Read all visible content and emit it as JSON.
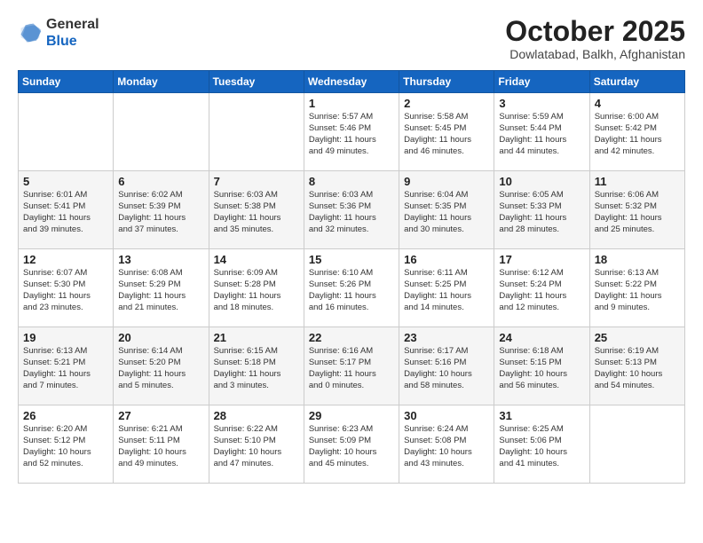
{
  "logo": {
    "general": "General",
    "blue": "Blue"
  },
  "title": "October 2025",
  "subtitle": "Dowlatabad, Balkh, Afghanistan",
  "weekdays": [
    "Sunday",
    "Monday",
    "Tuesday",
    "Wednesday",
    "Thursday",
    "Friday",
    "Saturday"
  ],
  "weeks": [
    [
      {
        "day": "",
        "info": ""
      },
      {
        "day": "",
        "info": ""
      },
      {
        "day": "",
        "info": ""
      },
      {
        "day": "1",
        "info": "Sunrise: 5:57 AM\nSunset: 5:46 PM\nDaylight: 11 hours\nand 49 minutes."
      },
      {
        "day": "2",
        "info": "Sunrise: 5:58 AM\nSunset: 5:45 PM\nDaylight: 11 hours\nand 46 minutes."
      },
      {
        "day": "3",
        "info": "Sunrise: 5:59 AM\nSunset: 5:44 PM\nDaylight: 11 hours\nand 44 minutes."
      },
      {
        "day": "4",
        "info": "Sunrise: 6:00 AM\nSunset: 5:42 PM\nDaylight: 11 hours\nand 42 minutes."
      }
    ],
    [
      {
        "day": "5",
        "info": "Sunrise: 6:01 AM\nSunset: 5:41 PM\nDaylight: 11 hours\nand 39 minutes."
      },
      {
        "day": "6",
        "info": "Sunrise: 6:02 AM\nSunset: 5:39 PM\nDaylight: 11 hours\nand 37 minutes."
      },
      {
        "day": "7",
        "info": "Sunrise: 6:03 AM\nSunset: 5:38 PM\nDaylight: 11 hours\nand 35 minutes."
      },
      {
        "day": "8",
        "info": "Sunrise: 6:03 AM\nSunset: 5:36 PM\nDaylight: 11 hours\nand 32 minutes."
      },
      {
        "day": "9",
        "info": "Sunrise: 6:04 AM\nSunset: 5:35 PM\nDaylight: 11 hours\nand 30 minutes."
      },
      {
        "day": "10",
        "info": "Sunrise: 6:05 AM\nSunset: 5:33 PM\nDaylight: 11 hours\nand 28 minutes."
      },
      {
        "day": "11",
        "info": "Sunrise: 6:06 AM\nSunset: 5:32 PM\nDaylight: 11 hours\nand 25 minutes."
      }
    ],
    [
      {
        "day": "12",
        "info": "Sunrise: 6:07 AM\nSunset: 5:30 PM\nDaylight: 11 hours\nand 23 minutes."
      },
      {
        "day": "13",
        "info": "Sunrise: 6:08 AM\nSunset: 5:29 PM\nDaylight: 11 hours\nand 21 minutes."
      },
      {
        "day": "14",
        "info": "Sunrise: 6:09 AM\nSunset: 5:28 PM\nDaylight: 11 hours\nand 18 minutes."
      },
      {
        "day": "15",
        "info": "Sunrise: 6:10 AM\nSunset: 5:26 PM\nDaylight: 11 hours\nand 16 minutes."
      },
      {
        "day": "16",
        "info": "Sunrise: 6:11 AM\nSunset: 5:25 PM\nDaylight: 11 hours\nand 14 minutes."
      },
      {
        "day": "17",
        "info": "Sunrise: 6:12 AM\nSunset: 5:24 PM\nDaylight: 11 hours\nand 12 minutes."
      },
      {
        "day": "18",
        "info": "Sunrise: 6:13 AM\nSunset: 5:22 PM\nDaylight: 11 hours\nand 9 minutes."
      }
    ],
    [
      {
        "day": "19",
        "info": "Sunrise: 6:13 AM\nSunset: 5:21 PM\nDaylight: 11 hours\nand 7 minutes."
      },
      {
        "day": "20",
        "info": "Sunrise: 6:14 AM\nSunset: 5:20 PM\nDaylight: 11 hours\nand 5 minutes."
      },
      {
        "day": "21",
        "info": "Sunrise: 6:15 AM\nSunset: 5:18 PM\nDaylight: 11 hours\nand 3 minutes."
      },
      {
        "day": "22",
        "info": "Sunrise: 6:16 AM\nSunset: 5:17 PM\nDaylight: 11 hours\nand 0 minutes."
      },
      {
        "day": "23",
        "info": "Sunrise: 6:17 AM\nSunset: 5:16 PM\nDaylight: 10 hours\nand 58 minutes."
      },
      {
        "day": "24",
        "info": "Sunrise: 6:18 AM\nSunset: 5:15 PM\nDaylight: 10 hours\nand 56 minutes."
      },
      {
        "day": "25",
        "info": "Sunrise: 6:19 AM\nSunset: 5:13 PM\nDaylight: 10 hours\nand 54 minutes."
      }
    ],
    [
      {
        "day": "26",
        "info": "Sunrise: 6:20 AM\nSunset: 5:12 PM\nDaylight: 10 hours\nand 52 minutes."
      },
      {
        "day": "27",
        "info": "Sunrise: 6:21 AM\nSunset: 5:11 PM\nDaylight: 10 hours\nand 49 minutes."
      },
      {
        "day": "28",
        "info": "Sunrise: 6:22 AM\nSunset: 5:10 PM\nDaylight: 10 hours\nand 47 minutes."
      },
      {
        "day": "29",
        "info": "Sunrise: 6:23 AM\nSunset: 5:09 PM\nDaylight: 10 hours\nand 45 minutes."
      },
      {
        "day": "30",
        "info": "Sunrise: 6:24 AM\nSunset: 5:08 PM\nDaylight: 10 hours\nand 43 minutes."
      },
      {
        "day": "31",
        "info": "Sunrise: 6:25 AM\nSunset: 5:06 PM\nDaylight: 10 hours\nand 41 minutes."
      },
      {
        "day": "",
        "info": ""
      }
    ]
  ]
}
